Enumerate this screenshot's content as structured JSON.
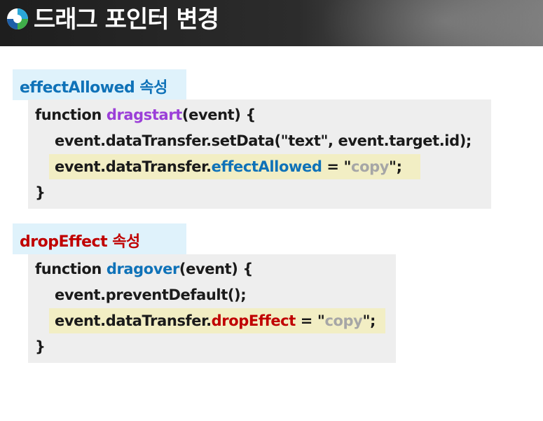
{
  "slide": {
    "title": "드래그 포인터 변경",
    "logo_icon": "circle-swirl-logo-icon",
    "colors": {
      "header": "#2a2a2a",
      "label_bg": "#dff2fb",
      "code_bg": "#eeeeee",
      "highlight_bg": "#f2eec4",
      "purple": "#9b3fd8",
      "blue": "#0f72b8",
      "red": "#c00000",
      "gray": "#a6a6a6"
    }
  },
  "section1": {
    "label": "effectAllowed 속성",
    "line1": {
      "kw": "function ",
      "fname": "dragstart",
      "rest": "(event)  {"
    },
    "line2": "event.dataTransfer.setData(\"text\", event.target.id);",
    "line3": {
      "pre": "event.dataTransfer.",
      "prop": "effectAllowed",
      "eq": " = \"",
      "val": "copy",
      "end": "\";"
    },
    "line4": "}"
  },
  "section2": {
    "label": "dropEffect 속성",
    "line1": {
      "kw": "function ",
      "fname": "dragover",
      "rest": "(event)  {"
    },
    "line2": "event.preventDefault();",
    "line3": {
      "pre": "event.dataTransfer.",
      "prop": "dropEffect",
      "eq": " = \"",
      "val": "copy",
      "end": "\";"
    },
    "line4": "}"
  }
}
